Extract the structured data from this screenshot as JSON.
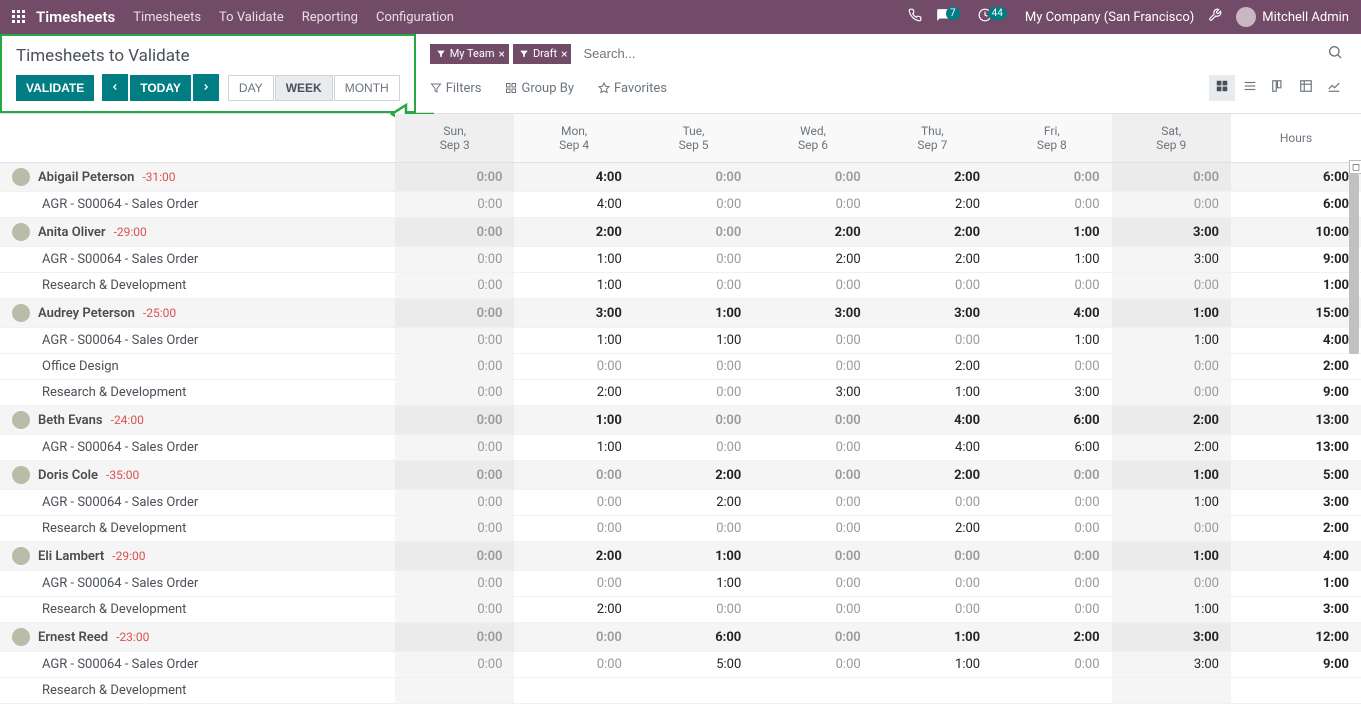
{
  "topbar": {
    "brand": "Timesheets",
    "nav": [
      "Timesheets",
      "To Validate",
      "Reporting",
      "Configuration"
    ],
    "chat_badge": "7",
    "activity_badge": "44",
    "company": "My Company (San Francisco)",
    "user": "Mitchell Admin"
  },
  "page": {
    "title": "Timesheets to Validate",
    "validate_btn": "VALIDATE",
    "today_btn": "TODAY",
    "range_tabs": [
      "DAY",
      "WEEK",
      "MONTH"
    ],
    "active_range": "WEEK"
  },
  "search": {
    "facets": [
      "My Team",
      "Draft"
    ],
    "placeholder": "Search..."
  },
  "filters": {
    "filters_label": "Filters",
    "groupby_label": "Group By",
    "favorites_label": "Favorites"
  },
  "columns": [
    {
      "l1": "Sun,",
      "l2": "Sep 3",
      "weekend": true
    },
    {
      "l1": "Mon,",
      "l2": "Sep 4",
      "weekend": false
    },
    {
      "l1": "Tue,",
      "l2": "Sep 5",
      "weekend": false
    },
    {
      "l1": "Wed,",
      "l2": "Sep 6",
      "weekend": false
    },
    {
      "l1": "Thu,",
      "l2": "Sep 7",
      "weekend": false
    },
    {
      "l1": "Fri,",
      "l2": "Sep 8",
      "weekend": false
    },
    {
      "l1": "Sat,",
      "l2": "Sep 9",
      "weekend": true
    }
  ],
  "hours_label": "Hours",
  "rows": [
    {
      "type": "emp",
      "name": "Abigail Peterson",
      "neg": "-31:00",
      "cells": [
        "0:00",
        "4:00",
        "0:00",
        "0:00",
        "2:00",
        "0:00",
        "0:00"
      ],
      "hours": "6:00"
    },
    {
      "type": "sub",
      "name": "AGR - S00064 - Sales Order",
      "cells": [
        "0:00",
        "4:00",
        "0:00",
        "0:00",
        "2:00",
        "0:00",
        "0:00"
      ],
      "hours": "6:00"
    },
    {
      "type": "emp",
      "name": "Anita Oliver",
      "neg": "-29:00",
      "cells": [
        "0:00",
        "2:00",
        "0:00",
        "2:00",
        "2:00",
        "1:00",
        "3:00"
      ],
      "hours": "10:00"
    },
    {
      "type": "sub",
      "name": "AGR - S00064 - Sales Order",
      "cells": [
        "0:00",
        "1:00",
        "0:00",
        "2:00",
        "2:00",
        "1:00",
        "3:00"
      ],
      "hours": "9:00"
    },
    {
      "type": "sub",
      "name": "Research & Development",
      "cells": [
        "0:00",
        "1:00",
        "0:00",
        "0:00",
        "0:00",
        "0:00",
        "0:00"
      ],
      "hours": "1:00"
    },
    {
      "type": "emp",
      "name": "Audrey Peterson",
      "neg": "-25:00",
      "cells": [
        "0:00",
        "3:00",
        "1:00",
        "3:00",
        "3:00",
        "4:00",
        "1:00"
      ],
      "hours": "15:00"
    },
    {
      "type": "sub",
      "name": "AGR - S00064 - Sales Order",
      "cells": [
        "0:00",
        "1:00",
        "1:00",
        "0:00",
        "0:00",
        "1:00",
        "1:00"
      ],
      "hours": "4:00"
    },
    {
      "type": "sub",
      "name": "Office Design",
      "cells": [
        "0:00",
        "0:00",
        "0:00",
        "0:00",
        "2:00",
        "0:00",
        "0:00"
      ],
      "hours": "2:00"
    },
    {
      "type": "sub",
      "name": "Research & Development",
      "cells": [
        "0:00",
        "2:00",
        "0:00",
        "3:00",
        "1:00",
        "3:00",
        "0:00"
      ],
      "hours": "9:00"
    },
    {
      "type": "emp",
      "name": "Beth Evans",
      "neg": "-24:00",
      "cells": [
        "0:00",
        "1:00",
        "0:00",
        "0:00",
        "4:00",
        "6:00",
        "2:00"
      ],
      "hours": "13:00"
    },
    {
      "type": "sub",
      "name": "AGR - S00064 - Sales Order",
      "cells": [
        "0:00",
        "1:00",
        "0:00",
        "0:00",
        "4:00",
        "6:00",
        "2:00"
      ],
      "hours": "13:00"
    },
    {
      "type": "emp",
      "name": "Doris Cole",
      "neg": "-35:00",
      "cells": [
        "0:00",
        "0:00",
        "2:00",
        "0:00",
        "2:00",
        "0:00",
        "1:00"
      ],
      "hours": "5:00"
    },
    {
      "type": "sub",
      "name": "AGR - S00064 - Sales Order",
      "cells": [
        "0:00",
        "0:00",
        "2:00",
        "0:00",
        "0:00",
        "0:00",
        "1:00"
      ],
      "hours": "3:00"
    },
    {
      "type": "sub",
      "name": "Research & Development",
      "cells": [
        "0:00",
        "0:00",
        "0:00",
        "0:00",
        "2:00",
        "0:00",
        "0:00"
      ],
      "hours": "2:00"
    },
    {
      "type": "emp",
      "name": "Eli Lambert",
      "neg": "-29:00",
      "cells": [
        "0:00",
        "2:00",
        "1:00",
        "0:00",
        "0:00",
        "0:00",
        "1:00"
      ],
      "hours": "4:00"
    },
    {
      "type": "sub",
      "name": "AGR - S00064 - Sales Order",
      "cells": [
        "0:00",
        "0:00",
        "1:00",
        "0:00",
        "0:00",
        "0:00",
        "0:00"
      ],
      "hours": "1:00"
    },
    {
      "type": "sub",
      "name": "Research & Development",
      "cells": [
        "0:00",
        "2:00",
        "0:00",
        "0:00",
        "0:00",
        "0:00",
        "1:00"
      ],
      "hours": "3:00"
    },
    {
      "type": "emp",
      "name": "Ernest Reed",
      "neg": "-23:00",
      "cells": [
        "0:00",
        "0:00",
        "6:00",
        "0:00",
        "1:00",
        "2:00",
        "3:00"
      ],
      "hours": "12:00"
    },
    {
      "type": "sub",
      "name": "AGR - S00064 - Sales Order",
      "cells": [
        "0:00",
        "0:00",
        "5:00",
        "0:00",
        "1:00",
        "0:00",
        "3:00"
      ],
      "hours": "9:00"
    },
    {
      "type": "sub",
      "name": "Research & Development",
      "cells": [
        "",
        "",
        "",
        "",
        "",
        "",
        ""
      ],
      "hours": ""
    }
  ]
}
